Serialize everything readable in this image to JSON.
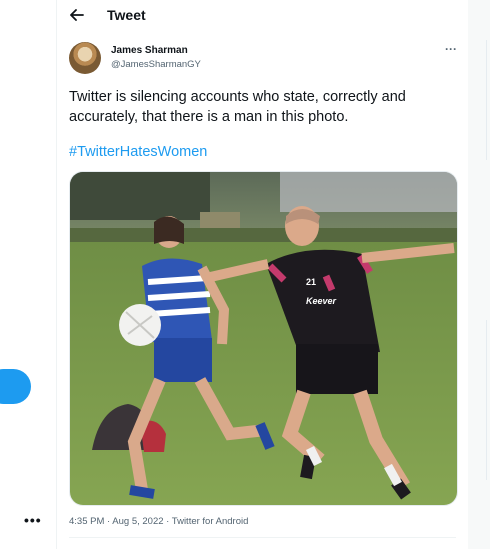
{
  "header": {
    "title": "Tweet",
    "back_icon": "arrow-left-icon"
  },
  "tweet": {
    "author_name": "James Sharman",
    "author_handle": "@JamesSharmanGY",
    "more_icon": "ellipsis-icon",
    "text": "Twitter is silencing accounts who state, correctly and accurately, that there is a man in this photo.",
    "hashtag": "#TwitterHatesWomen",
    "timestamp": "4:35 PM · Aug 5, 2022 · Twitter for Android"
  },
  "photo": {
    "jersey_left": "",
    "jersey_right_number": "21",
    "jersey_right_sponsor": "Keever"
  },
  "sidebar": {
    "more_icon": "ellipsis-icon",
    "compose_color": "#1d9bf0"
  },
  "colors": {
    "accent": "#1d9bf0",
    "text": "#0f1419",
    "muted": "#536471",
    "background": "#f7f9f9"
  }
}
